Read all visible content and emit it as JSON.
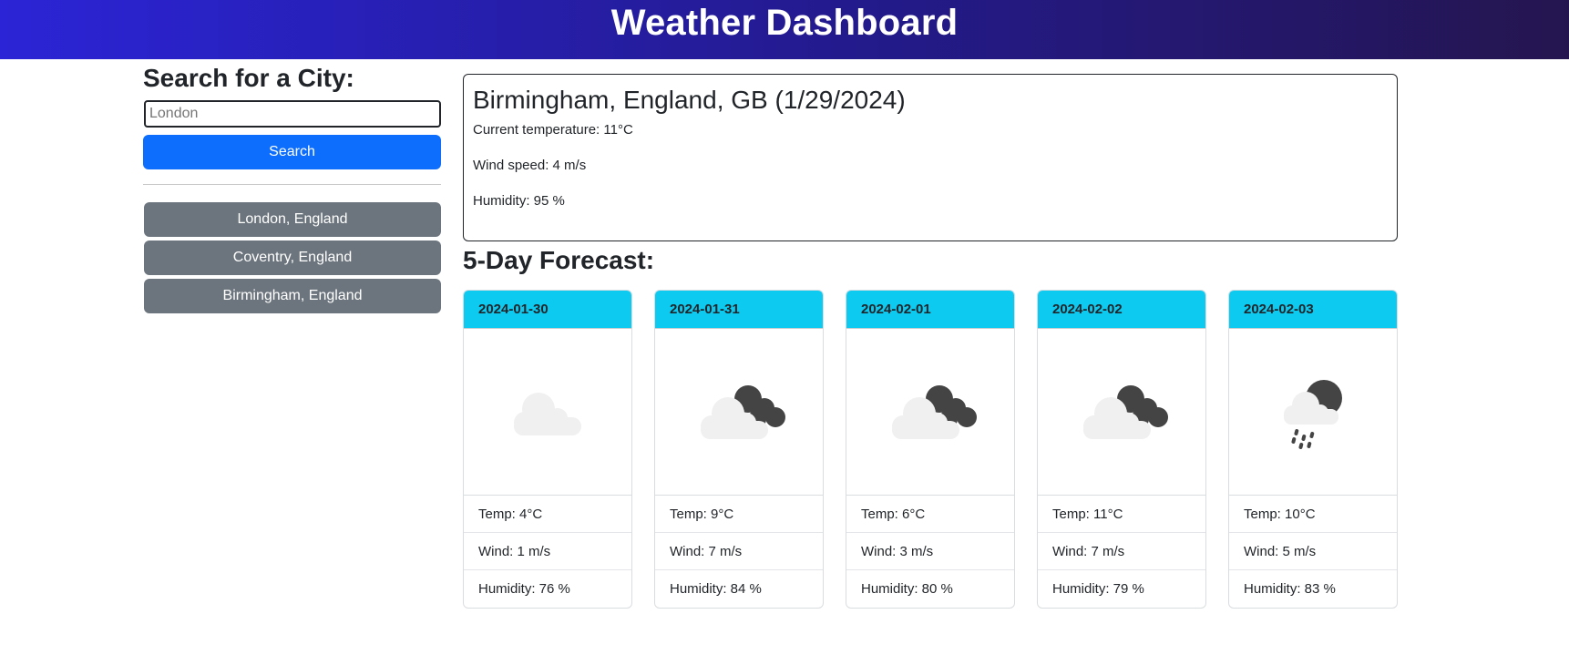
{
  "header": {
    "title": "Weather Dashboard"
  },
  "search": {
    "heading": "Search for a City:",
    "placeholder": "London",
    "button_label": "Search"
  },
  "history": [
    {
      "label": "London, England"
    },
    {
      "label": "Coventry, England"
    },
    {
      "label": "Birmingham, England"
    }
  ],
  "current": {
    "title": "Birmingham, England, GB (1/29/2024)",
    "temperature": "Current temperature: 11°C",
    "wind": "Wind speed: 4 m/s",
    "humidity": "Humidity: 95 %"
  },
  "forecast": {
    "title": "5-Day Forecast:",
    "days": [
      {
        "date": "2024-01-30",
        "icon": "cloud-icon",
        "temp": "Temp: 4°C",
        "wind": "Wind: 1 m/s",
        "humidity": "Humidity: 76 %"
      },
      {
        "date": "2024-01-31",
        "icon": "broken-clouds-icon",
        "temp": "Temp: 9°C",
        "wind": "Wind: 7 m/s",
        "humidity": "Humidity: 84 %"
      },
      {
        "date": "2024-02-01",
        "icon": "broken-clouds-icon",
        "temp": "Temp: 6°C",
        "wind": "Wind: 3 m/s",
        "humidity": "Humidity: 80 %"
      },
      {
        "date": "2024-02-02",
        "icon": "broken-clouds-icon",
        "temp": "Temp: 11°C",
        "wind": "Wind: 7 m/s",
        "humidity": "Humidity: 79 %"
      },
      {
        "date": "2024-02-03",
        "icon": "rain-icon",
        "temp": "Temp: 10°C",
        "wind": "Wind: 5 m/s",
        "humidity": "Humidity: 83 %"
      }
    ]
  },
  "colors": {
    "header_gradient_start": "#2b24d6",
    "header_gradient_end": "#25154f",
    "primary": "#0d6efd",
    "secondary": "#6c757d",
    "info": "#0dcaf0"
  }
}
